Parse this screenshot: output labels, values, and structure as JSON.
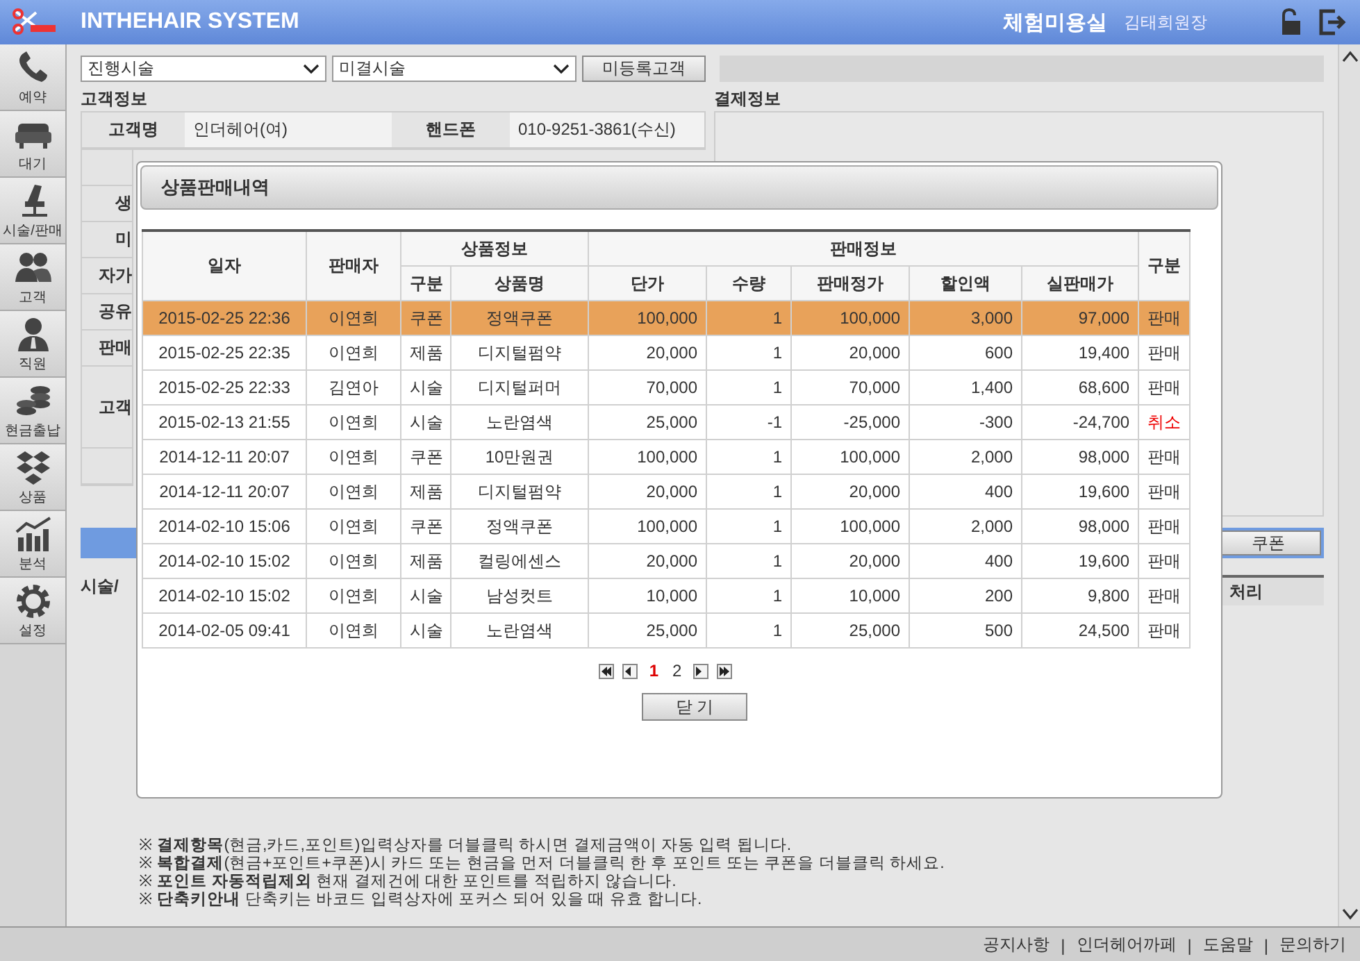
{
  "header": {
    "app_title": "INTHEHAIR SYSTEM",
    "shop_name": "체험미용실",
    "user_name": "김태희원장"
  },
  "sidebar": {
    "items": [
      {
        "label": "예약"
      },
      {
        "label": "대기"
      },
      {
        "label": "시술/판매"
      },
      {
        "label": "고객"
      },
      {
        "label": "직원"
      },
      {
        "label": "현금출납"
      },
      {
        "label": "상품"
      },
      {
        "label": "분석"
      },
      {
        "label": "설정"
      }
    ]
  },
  "toolbar": {
    "select_1": "진행시술",
    "select_2": "미결시술",
    "button": "미등록고객"
  },
  "customer_info": {
    "title": "고객정보",
    "name_label": "고객명",
    "name_value": "인더헤어(여)",
    "phone_label": "핸드폰",
    "phone_value": "010-9251-3861(수신)",
    "partial_labels": [
      "생",
      "미",
      "자가",
      "공유",
      "판매",
      "고객"
    ]
  },
  "payment_info": {
    "title": "결제정보"
  },
  "coupon_button": "쿠폰",
  "history_title": "시술/",
  "history_column": "처리",
  "notes": [
    "※ **결제항목**(현금,카드,포인트)입력상자를 더블클릭 하시면 결제금액이 자동 입력 됩니다.",
    "※ **복합결제**(현금+포인트+쿠폰)시 카드 또는 현금을 먼저 더블클릭 한 후 포인트 또는 쿠폰을 더블클릭 하세요.",
    "※ **포인트 자동적립제외** 현재 결제건에 대한 포인트를 적립하지 않습니다.",
    "※ **단축키안내** 단축키는 바코드 입력상자에 포커스 되어 있을 때 유효 합니다."
  ],
  "footer": {
    "links": [
      "공지사항",
      "인더헤어까페",
      "도움말",
      "문의하기"
    ],
    "separators": [
      "|",
      "|",
      "|"
    ]
  },
  "dialog": {
    "title": "상품판매내역",
    "group_headers": [
      "상품정보",
      "판매정보"
    ],
    "columns": [
      "일자",
      "판매자",
      "구분",
      "상품명",
      "단가",
      "수량",
      "판매정가",
      "할인액",
      "실판매가",
      "구분"
    ],
    "rows": [
      {
        "date": "2015-02-25 22:36",
        "seller": "이연희",
        "type": "쿠폰",
        "product": "정액쿠폰",
        "price": "100,000",
        "qty": "1",
        "list_price": "100,000",
        "discount": "3,000",
        "final": "97,000",
        "status": "판매",
        "cancelled": false,
        "selected": true
      },
      {
        "date": "2015-02-25 22:35",
        "seller": "이연희",
        "type": "제품",
        "product": "디지털펌약",
        "price": "20,000",
        "qty": "1",
        "list_price": "20,000",
        "discount": "600",
        "final": "19,400",
        "status": "판매",
        "cancelled": false,
        "selected": false
      },
      {
        "date": "2015-02-25 22:33",
        "seller": "김연아",
        "type": "시술",
        "product": "디지털퍼머",
        "price": "70,000",
        "qty": "1",
        "list_price": "70,000",
        "discount": "1,400",
        "final": "68,600",
        "status": "판매",
        "cancelled": false,
        "selected": false
      },
      {
        "date": "2015-02-13 21:55",
        "seller": "이연희",
        "type": "시술",
        "product": "노란염색",
        "price": "25,000",
        "qty": "-1",
        "list_price": "-25,000",
        "discount": "-300",
        "final": "-24,700",
        "status": "취소",
        "cancelled": true,
        "selected": false
      },
      {
        "date": "2014-12-11 20:07",
        "seller": "이연희",
        "type": "쿠폰",
        "product": "10만원권",
        "price": "100,000",
        "qty": "1",
        "list_price": "100,000",
        "discount": "2,000",
        "final": "98,000",
        "status": "판매",
        "cancelled": false,
        "selected": false
      },
      {
        "date": "2014-12-11 20:07",
        "seller": "이연희",
        "type": "제품",
        "product": "디지털펌약",
        "price": "20,000",
        "qty": "1",
        "list_price": "20,000",
        "discount": "400",
        "final": "19,600",
        "status": "판매",
        "cancelled": false,
        "selected": false
      },
      {
        "date": "2014-02-10 15:06",
        "seller": "이연희",
        "type": "쿠폰",
        "product": "정액쿠폰",
        "price": "100,000",
        "qty": "1",
        "list_price": "100,000",
        "discount": "2,000",
        "final": "98,000",
        "status": "판매",
        "cancelled": false,
        "selected": false
      },
      {
        "date": "2014-02-10 15:02",
        "seller": "이연희",
        "type": "제품",
        "product": "컬링에센스",
        "price": "20,000",
        "qty": "1",
        "list_price": "20,000",
        "discount": "400",
        "final": "19,600",
        "status": "판매",
        "cancelled": false,
        "selected": false
      },
      {
        "date": "2014-02-10 15:02",
        "seller": "이연희",
        "type": "시술",
        "product": "남성컷트",
        "price": "10,000",
        "qty": "1",
        "list_price": "10,000",
        "discount": "200",
        "final": "9,800",
        "status": "판매",
        "cancelled": false,
        "selected": false
      },
      {
        "date": "2014-02-05 09:41",
        "seller": "이연희",
        "type": "시술",
        "product": "노란염색",
        "price": "25,000",
        "qty": "1",
        "list_price": "25,000",
        "discount": "500",
        "final": "24,500",
        "status": "판매",
        "cancelled": false,
        "selected": false
      }
    ],
    "pages": [
      {
        "label": "1",
        "selected": true
      },
      {
        "label": "2",
        "selected": false
      }
    ],
    "close_button": "닫 기"
  }
}
